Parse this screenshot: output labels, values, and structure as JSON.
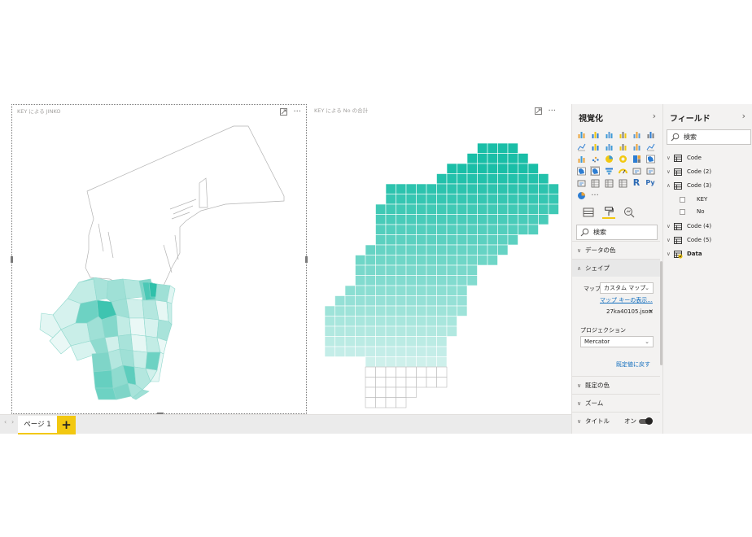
{
  "canvas": {
    "left_visual_title": "KEY による JINKO",
    "right_visual_title": "KEY による No の合計"
  },
  "page_bar": {
    "prev": "‹",
    "next": "›",
    "page_tab": "ページ 1",
    "add_page": "+"
  },
  "viz_pane": {
    "title": "視覚化",
    "collapse": "›",
    "search_placeholder": "検索",
    "sections": {
      "data_color": "データの色",
      "shape": "シェイプ",
      "default_color": "既定の色",
      "zoom": "ズーム",
      "title": "タイトル"
    },
    "shape": {
      "map_label": "マップ",
      "map_value": "カスタム マップ",
      "map_key_link": "マップ キーの表示...",
      "file_name": "27ka40105.json",
      "file_remove": "✕",
      "projection_label": "プロジェクション",
      "projection_value": "Mercator",
      "reset_link": "既定値に戻す"
    },
    "title_toggle_label": "オン",
    "more_visuals": "···"
  },
  "fields_pane": {
    "title": "フィールド",
    "collapse": "›",
    "search_placeholder": "検索",
    "tables": [
      {
        "name": "Code",
        "expanded": false
      },
      {
        "name": "Code (2)",
        "expanded": false
      },
      {
        "name": "Code (3)",
        "expanded": true,
        "fields": [
          "KEY",
          "No"
        ]
      },
      {
        "name": "Code (4)",
        "expanded": false
      },
      {
        "name": "Code (5)",
        "expanded": false
      },
      {
        "name": "Data",
        "expanded": false,
        "bold": true
      }
    ]
  },
  "colors": {
    "accent": "#f2c811",
    "map_fill_light": "#eaf8f6",
    "map_fill_dark": "#1abea7",
    "link": "#0f6cbd"
  }
}
